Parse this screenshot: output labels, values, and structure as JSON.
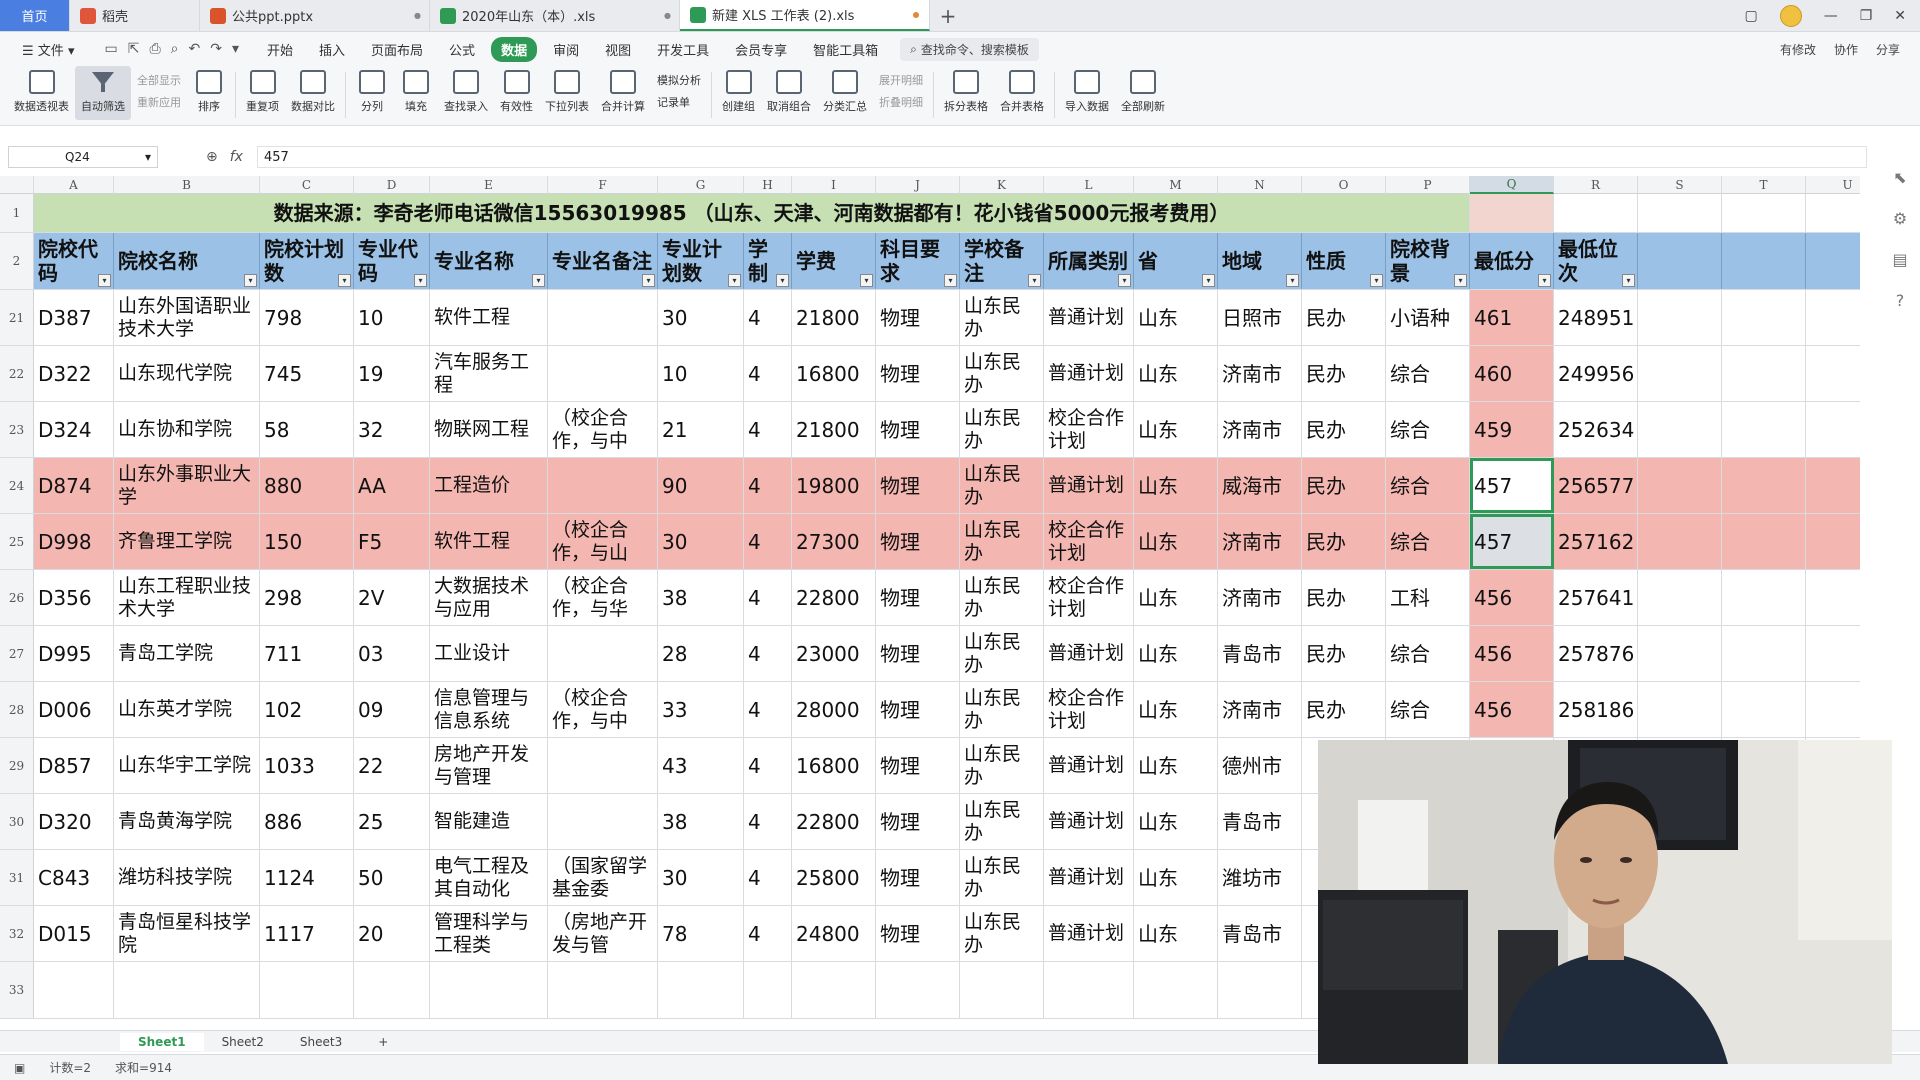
{
  "tabs": [
    {
      "label": "首页",
      "kind": "home"
    },
    {
      "label": "稻壳",
      "icon": "docer-icon",
      "color": "#e0553b"
    },
    {
      "label": "公共ppt.pptx",
      "icon": "ppt-icon",
      "color": "#d9542b"
    },
    {
      "label": "2020年山东（本）.xls",
      "icon": "xls-icon",
      "color": "#2f9a55"
    },
    {
      "label": "新建 XLS 工作表 (2).xls",
      "icon": "xls-icon",
      "color": "#2f9a55",
      "active": true
    }
  ],
  "menu": {
    "file": "文件",
    "items": [
      "开始",
      "插入",
      "页面布局",
      "公式",
      "数据",
      "审阅",
      "视图",
      "开发工具",
      "会员专享",
      "智能工具箱"
    ],
    "active": "数据",
    "search": "查找命令、搜索模板",
    "right": [
      "有修改",
      "协作",
      "分享"
    ]
  },
  "ribbon": {
    "pivot": "数据透视表",
    "autofilter": "自动筛选",
    "showall": "全部显示",
    "reapply": "重新应用",
    "sort": "排序",
    "dup": "重复项",
    "compare": "数据对比",
    "split": "分列",
    "fill": "填充",
    "lookup": "查找录入",
    "valid": "有效性",
    "dropdown": "下拉列表",
    "merge": "合并计算",
    "simulate": "模拟分析",
    "record": "记录单",
    "group": "创建组",
    "ungroup": "取消组合",
    "subtotal": "分类汇总",
    "expand": "展开明细",
    "collapse": "折叠明细",
    "splittable": "拆分表格",
    "mergetable": "合并表格",
    "import": "导入数据",
    "refresh": "全部刷新"
  },
  "formula": {
    "cell": "Q24",
    "value": "457"
  },
  "columns": [
    "A",
    "B",
    "C",
    "D",
    "E",
    "F",
    "G",
    "H",
    "I",
    "J",
    "K",
    "L",
    "M",
    "N",
    "O",
    "P",
    "Q",
    "R",
    "S",
    "T",
    "U"
  ],
  "title_row": "数据来源：李奇老师电话微信15563019985 （山东、天津、河南数据都有！花小钱省5000元报考费用）",
  "headers": [
    "院校代码",
    "院校名称",
    "院校计划数",
    "专业代码",
    "专业名称",
    "专业名备注",
    "专业计划数",
    "学制",
    "学费",
    "科目要求",
    "学校备注",
    "所属类别",
    "省",
    "地域",
    "性质",
    "院校背景",
    "最低分",
    "最低位次"
  ],
  "rows": [
    {
      "num": "21",
      "cells": [
        "D387",
        "山东外国语职业技术大学",
        "798",
        "10",
        "软件工程",
        "",
        "30",
        "4",
        "21800",
        "物理",
        "山东民办",
        "普通计划",
        "山东",
        "日照市",
        "民办",
        "小语种",
        "461",
        "248951"
      ]
    },
    {
      "num": "22",
      "cells": [
        "D322",
        "山东现代学院",
        "745",
        "19",
        "汽车服务工程",
        "",
        "10",
        "4",
        "16800",
        "物理",
        "山东民办",
        "普通计划",
        "山东",
        "济南市",
        "民办",
        "综合",
        "460",
        "249956"
      ]
    },
    {
      "num": "23",
      "cells": [
        "D324",
        "山东协和学院",
        "58",
        "32",
        "物联网工程",
        "（校企合作，与中",
        "21",
        "4",
        "21800",
        "物理",
        "山东民办",
        "校企合作计划",
        "山东",
        "济南市",
        "民办",
        "综合",
        "459",
        "252634"
      ]
    },
    {
      "num": "24",
      "pink": true,
      "cells": [
        "D874",
        "山东外事职业大学",
        "880",
        "AA",
        "工程造价",
        "",
        "90",
        "4",
        "19800",
        "物理",
        "山东民办",
        "普通计划",
        "山东",
        "威海市",
        "民办",
        "综合",
        "457",
        "256577"
      ]
    },
    {
      "num": "25",
      "pink": true,
      "cells": [
        "D998",
        "齐鲁理工学院",
        "150",
        "F5",
        "软件工程",
        "（校企合作，与山",
        "30",
        "4",
        "27300",
        "物理",
        "山东民办",
        "校企合作计划",
        "山东",
        "济南市",
        "民办",
        "综合",
        "457",
        "257162"
      ]
    },
    {
      "num": "26",
      "cells": [
        "D356",
        "山东工程职业技术大学",
        "298",
        "2V",
        "大数据技术与应用",
        "（校企合作，与华",
        "38",
        "4",
        "22800",
        "物理",
        "山东民办",
        "校企合作计划",
        "山东",
        "济南市",
        "民办",
        "工科",
        "456",
        "257641"
      ]
    },
    {
      "num": "27",
      "cells": [
        "D995",
        "青岛工学院",
        "711",
        "03",
        "工业设计",
        "",
        "28",
        "4",
        "23000",
        "物理",
        "山东民办",
        "普通计划",
        "山东",
        "青岛市",
        "民办",
        "综合",
        "456",
        "257876"
      ]
    },
    {
      "num": "28",
      "cells": [
        "D006",
        "山东英才学院",
        "102",
        "09",
        "信息管理与信息系统",
        "（校企合作，与中",
        "33",
        "4",
        "28000",
        "物理",
        "山东民办",
        "校企合作计划",
        "山东",
        "济南市",
        "民办",
        "综合",
        "456",
        "258186"
      ]
    },
    {
      "num": "29",
      "cells": [
        "D857",
        "山东华宇工学院",
        "1033",
        "22",
        "房地产开发与管理",
        "",
        "43",
        "4",
        "16800",
        "物理",
        "山东民办",
        "普通计划",
        "山东",
        "德州市",
        "",
        "",
        "",
        ""
      ]
    },
    {
      "num": "30",
      "cells": [
        "D320",
        "青岛黄海学院",
        "886",
        "25",
        "智能建造",
        "",
        "38",
        "4",
        "22800",
        "物理",
        "山东民办",
        "普通计划",
        "山东",
        "青岛市",
        "",
        "",
        "",
        ""
      ]
    },
    {
      "num": "31",
      "cells": [
        "C843",
        "潍坊科技学院",
        "1124",
        "50",
        "电气工程及其自动化",
        "（国家留学基金委",
        "30",
        "4",
        "25800",
        "物理",
        "山东民办",
        "普通计划",
        "山东",
        "潍坊市",
        "",
        "",
        "",
        ""
      ]
    },
    {
      "num": "32",
      "cells": [
        "D015",
        "青岛恒星科技学院",
        "1117",
        "20",
        "管理科学与工程类",
        "（房地产开发与管",
        "78",
        "4",
        "24800",
        "物理",
        "山东民办",
        "普通计划",
        "山东",
        "青岛市",
        "",
        "",
        "",
        ""
      ]
    }
  ],
  "row_numbers_top": [
    "1",
    "2"
  ],
  "row_33": "33",
  "sheets": [
    "Sheet1",
    "Sheet2",
    "Sheet3"
  ],
  "status": {
    "count": "计数=2",
    "sum": "求和=914"
  },
  "colors": {
    "accent": "#2f9a55",
    "header": "#9bc2e6",
    "title": "#c6e0b4",
    "highlight": "#f4b6b0"
  }
}
